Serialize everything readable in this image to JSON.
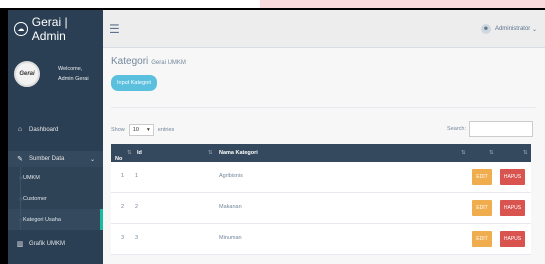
{
  "app": {
    "title": "Gerai | Admin",
    "logo_icon": "cloud-icon"
  },
  "profile": {
    "welcome": "Welcome,",
    "name": "Admin Gerai",
    "avatar_text": "Gerai"
  },
  "sidebar": {
    "dashboard": "Dashboard",
    "sumber_data": "Sumber Data",
    "sub_items": [
      {
        "label": "UMKM"
      },
      {
        "label": "Customer"
      },
      {
        "label": "Kategori Usaha"
      }
    ],
    "grafik": "Grafik UMKM"
  },
  "topbar": {
    "user": "Administrator"
  },
  "page": {
    "title": "Kategori",
    "subtitle": "Gerai UMKM",
    "input_button": "Input Kategori"
  },
  "controls": {
    "show": "Show",
    "entries_value": "10",
    "entries": "entries",
    "search": "Search:"
  },
  "table": {
    "headers": {
      "no": "No",
      "id": "Id",
      "nama": "Nama Kategori"
    },
    "rows": [
      {
        "no": "1",
        "id": "1",
        "nama": "Agribisnis"
      },
      {
        "no": "2",
        "id": "2",
        "nama": "Makanan"
      },
      {
        "no": "3",
        "id": "3",
        "nama": "Minuman"
      }
    ],
    "edit_label": "EDIT",
    "hapus_label": "HAPUS"
  },
  "colors": {
    "sidebar": "#2a3f54",
    "header": "#34495e",
    "accent": "#1abb9c",
    "edit": "#f0ad4e",
    "hapus": "#d9534f",
    "info": "#5bc0de"
  }
}
